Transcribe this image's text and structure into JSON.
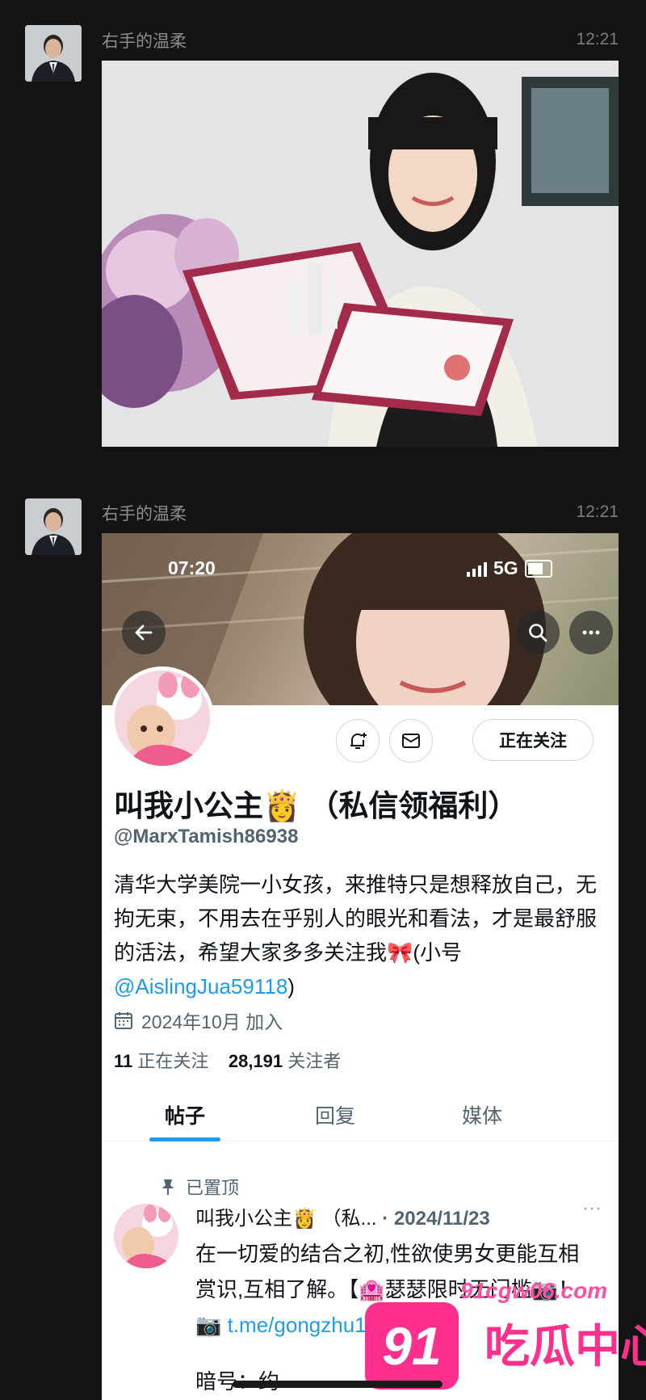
{
  "chat": {
    "messages": [
      {
        "sender": "右手的温柔",
        "time": "12:21"
      },
      {
        "sender": "右手的温柔",
        "time": "12:21"
      }
    ]
  },
  "profile_screen": {
    "status_time": "07:20",
    "network": "5G",
    "follow_label": "正在关注",
    "name": "叫我小公主👸 （私信领福利）",
    "handle": "@MarxTamish86938",
    "bio_text": "清华大学美院一小女孩，来推特只是想释放自己，无拘无束，不用去在乎别人的眼光和看法，才是最舒服的活法，希望大家多多关注我🎀(小号 ",
    "bio_mention": "@AislingJua59118",
    "bio_end": ")",
    "joined": "2024年10月 加入",
    "following_count": "11",
    "following_label": "正在关注",
    "followers_count": "28,191",
    "followers_label": "关注者",
    "tabs": [
      "帖子",
      "回复",
      "媒体"
    ],
    "pinned_label": "已置顶",
    "post": {
      "author": "叫我小公主👸 （私...",
      "date": "· 2024/11/23",
      "text": "在一切爱的结合之初,性欲使男女更能互相赏识,互相了解。【🏩瑟瑟限时无门槛📷！📷",
      "link": "t.me/gongzhu1",
      "code": "暗号：约"
    }
  },
  "watermark": {
    "url": "91cgw06.com",
    "badge": "91",
    "text": "吃瓜中心"
  },
  "colors": {
    "background": "#141414",
    "accent": "#1d9bf0",
    "watermark": "#ff2f8d"
  }
}
